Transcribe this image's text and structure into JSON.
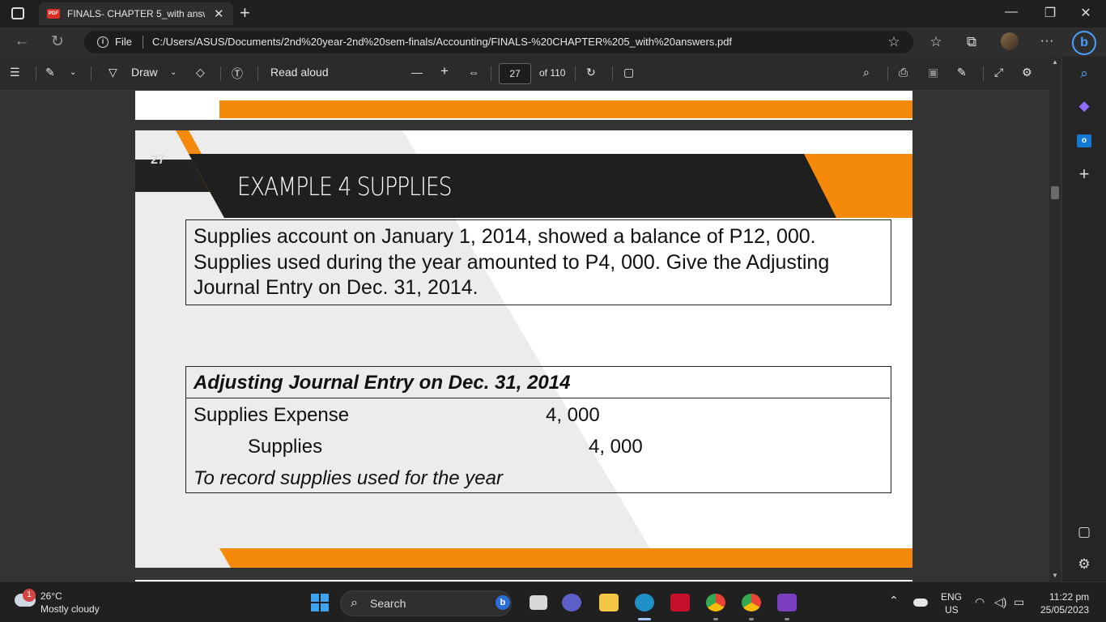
{
  "browser": {
    "tab_title": "FINALS- CHAPTER 5_with answer",
    "tab_close": "✕",
    "new_tab": "+",
    "minimize": "—",
    "restore": "❐",
    "close": "✕",
    "file_label": "File",
    "url": "C:/Users/ASUS/Documents/2nd%20year-2nd%20sem-finals/Accounting/FINALS-%20CHAPTER%205_with%20answers.pdf",
    "more": "···"
  },
  "pdf_toolbar": {
    "draw_label": "Draw",
    "read_aloud_label": "Read aloud",
    "zoom_out": "—",
    "zoom_in": "+",
    "page_number": "27",
    "page_total": "of 110"
  },
  "page": {
    "number": "27",
    "title": "EXAMPLE 4 SUPPLIES",
    "problem_lines": [
      "Supplies account on January 1, 2014, showed a balance of P12, 000.",
      "Supplies used during the year amounted to P4, 000. Give the Adjusting",
      "Journal Entry on Dec. 31, 2014."
    ],
    "entry": {
      "title": "Adjusting Journal Entry on Dec. 31, 2014",
      "debit_account": "Supplies Expense",
      "debit_amount": "4, 000",
      "credit_account": "Supplies",
      "credit_amount": "4, 000",
      "explanation": "To record supplies used for the year"
    }
  },
  "taskbar": {
    "weather_badge": "1",
    "temperature": "26°C",
    "weather": "Mostly cloudy",
    "search_label": "Search",
    "language": "ENG",
    "region": "US",
    "time": "11:22 pm",
    "date": "25/05/2023"
  },
  "colors": {
    "accent_orange": "#f58a0a",
    "slide_dark": "#1f1f1f"
  }
}
